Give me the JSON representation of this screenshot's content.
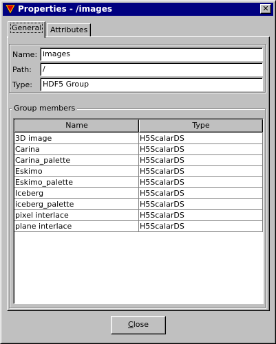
{
  "window": {
    "title": "Properties - /images",
    "close_glyph": "✕"
  },
  "tabs": [
    {
      "label": "General",
      "active": true
    },
    {
      "label": "Attributes",
      "active": false
    }
  ],
  "general": {
    "name_label": "Name:",
    "name_value": "images",
    "path_label": "Path:",
    "path_value": "/",
    "type_label": "Type:",
    "type_value": "HDF5 Group"
  },
  "group_members": {
    "title": "Group members",
    "columns": [
      "Name",
      "Type"
    ],
    "rows": [
      {
        "name": "3D image",
        "type": "H5ScalarDS"
      },
      {
        "name": "Carina",
        "type": "H5ScalarDS"
      },
      {
        "name": "Carina_palette",
        "type": "H5ScalarDS"
      },
      {
        "name": "Eskimo",
        "type": "H5ScalarDS"
      },
      {
        "name": "Eskimo_palette",
        "type": "H5ScalarDS"
      },
      {
        "name": "Iceberg",
        "type": "H5ScalarDS"
      },
      {
        "name": "iceberg_palette",
        "type": "H5ScalarDS"
      },
      {
        "name": "pixel interlace",
        "type": "H5ScalarDS"
      },
      {
        "name": "plane interlace",
        "type": "H5ScalarDS"
      }
    ]
  },
  "footer": {
    "close_button_mnemonic": "C",
    "close_button_rest": "lose"
  },
  "colors": {
    "titlebar": "#000080",
    "window_face": "#c0c0c0",
    "app_icon_red": "#e00000",
    "app_icon_yellow": "#ffcc00"
  }
}
